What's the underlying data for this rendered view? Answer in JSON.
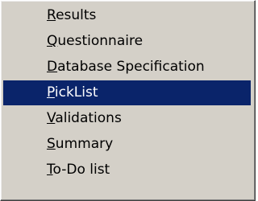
{
  "menu": {
    "items": [
      {
        "label": "Results",
        "mnemonic": "R",
        "rest": "esults",
        "selected": false
      },
      {
        "label": "Questionnaire",
        "mnemonic": "Q",
        "rest": "uestionnaire",
        "selected": false
      },
      {
        "label": "Database Specification",
        "mnemonic": "D",
        "rest": "atabase Specification",
        "selected": false
      },
      {
        "label": "PickList",
        "mnemonic": "P",
        "rest": "ickList",
        "selected": true
      },
      {
        "label": "Validations",
        "mnemonic": "V",
        "rest": "alidations",
        "selected": false
      },
      {
        "label": "Summary",
        "mnemonic": "S",
        "rest": "ummary",
        "selected": false
      },
      {
        "label": "To-Do list",
        "mnemonic": "T",
        "rest": "o-Do list",
        "selected": false
      }
    ],
    "colors": {
      "background": "#d4d0c8",
      "highlight": "#0a246a",
      "highlight_text": "#ffffff",
      "text": "#000000"
    }
  }
}
